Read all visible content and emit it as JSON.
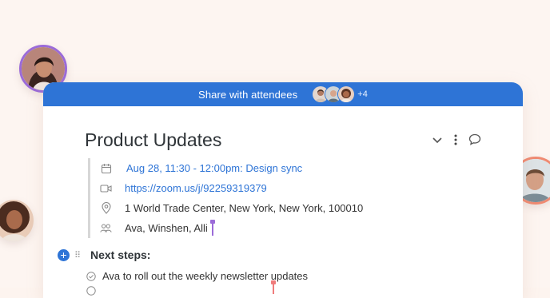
{
  "share_bar": {
    "label": "Share with attendees",
    "extra_count": "+4"
  },
  "event": {
    "title": "Product Updates",
    "datetime": "Aug 28, 11:30 - 12:00pm: Design sync",
    "link": "https://zoom.us/j/92259319379",
    "location": "1 World Trade Center, New York, New York, 100010",
    "attendees": "Ava, Winshen, Alli"
  },
  "next_steps": {
    "heading": "Next steps:",
    "tasks": [
      "Ava to roll out the weekly newsletter updates"
    ]
  },
  "colors": {
    "accent": "#2e74d6",
    "background": "#fdf4ef",
    "cursor_purple": "#9b6bd8",
    "cursor_pink": "#ef7c7c"
  },
  "icons": [
    "calendar-icon",
    "video-icon",
    "location-pin-icon",
    "people-icon",
    "chevron-down-icon",
    "more-vertical-icon",
    "comment-icon",
    "plus-icon",
    "drag-handle-icon",
    "check-circle-icon"
  ]
}
